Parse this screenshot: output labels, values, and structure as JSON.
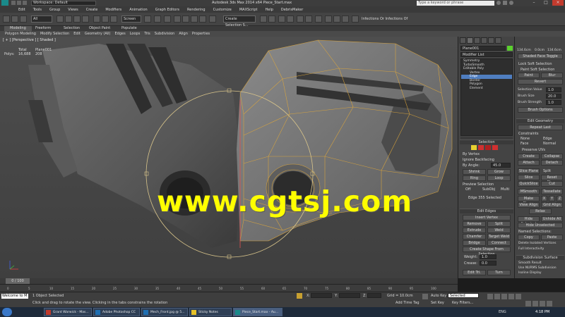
{
  "titlebar": {
    "workspace": "Workspace: Default",
    "title": "Autodesk 3ds Max 2014 x64    Piece_Start.max",
    "search_placeholder": "Type a keyword or phrase"
  },
  "menu": [
    "Edit",
    "Tools",
    "Group",
    "Views",
    "Create",
    "Modifiers",
    "Animation",
    "Graph Editors",
    "Rendering",
    "Customize",
    "MAXScript",
    "Help",
    "DebrisMaker"
  ],
  "toolbar": {
    "selection_filter": "All",
    "coord_system": "Screen",
    "named_selection": "Create Selection S...",
    "infections": "Infections Or Infections Of"
  },
  "ribbon": {
    "tabs": [
      "Modeling",
      "Freeform",
      "Selection",
      "Object Paint",
      "Populate"
    ],
    "items": [
      "Polygon Modeling",
      "Modify Selection",
      "Edit",
      "Geometry (All)",
      "Edges",
      "Loops",
      "Tris",
      "Subdivision",
      "Align",
      "Properties"
    ]
  },
  "viewport": {
    "label": "[ + ] [Perspective ] [ Shaded ]",
    "stats": {
      "col_total": "Total",
      "col_object": "Plane001",
      "row_label": "Polys:",
      "total": "16,688",
      "object": "208"
    },
    "watermark": "www.cgtsj.com"
  },
  "command_panel": {
    "object_name": "Plane001",
    "modifier_list": "Modifier List",
    "stack": [
      {
        "label": "Symmetry",
        "level": 0,
        "selected": false
      },
      {
        "label": "TurboSmooth",
        "level": 0,
        "selected": false
      },
      {
        "label": "Editable Poly",
        "level": 0,
        "selected": false
      },
      {
        "label": "Vertex",
        "level": 1,
        "selected": false
      },
      {
        "label": "Edge",
        "level": 1,
        "selected": true
      },
      {
        "label": "Border",
        "level": 1,
        "selected": false
      },
      {
        "label": "Polygon",
        "level": 1,
        "selected": false
      },
      {
        "label": "Element",
        "level": 1,
        "selected": false
      }
    ],
    "selection_rollout": "Selection",
    "by_vertex": "By Vertex",
    "ignore_backfacing": "Ignore Backfacing",
    "by_angle": "By Angle:",
    "by_angle_value": "45.0",
    "shrink": "Shrink",
    "grow": "Grow",
    "ring": "Ring",
    "loop": "Loop",
    "preview_selection": "Preview Selection",
    "preview_off": "Off",
    "preview_subobj": "SubObj",
    "preview_multi": "Multi",
    "selected_info": "Edge 355 Selected",
    "edit_edges_rollout": "Edit Edges",
    "insert_vertex": "Insert Vertex",
    "remove": "Remove",
    "split": "Split",
    "extrude": "Extrude",
    "weld": "Weld",
    "chamfer": "Chamfer",
    "target_weld": "Target Weld",
    "bridge": "Bridge",
    "connect": "Connect",
    "create_shape": "Create Shape From Selection",
    "weight_label": "Weight:",
    "weight_value": "1.0",
    "crease_label": "Crease:",
    "crease_value": "0.0",
    "edit_tri": "Edit Tri.",
    "turn": "Turn"
  },
  "right_panel": {
    "val1": "134.6cm",
    "val2": "0.0cm",
    "val3": "134.6cm",
    "shaded_toggle": "Shaded Face Toggle",
    "lock_soft": "Lock Soft Selection",
    "paint_soft": "Paint Soft Selection",
    "paint": "Paint",
    "blur": "Blur",
    "revert": "Revert",
    "selection_value": "Selection Value",
    "selection_value_num": "1.0",
    "brush_size": "Brush Size",
    "brush_size_num": "20.0",
    "brush_strength": "Brush Strength",
    "brush_strength_num": "1.0",
    "brush_options": "Brush Options",
    "edit_geometry": "Edit Geometry",
    "repeat_last": "Repeat Last",
    "constraints": "Constraints",
    "c_none": "None",
    "c_edge": "Edge",
    "c_face": "Face",
    "c_normal": "Normal",
    "preserve_uvs": "Preserve UVs",
    "create": "Create",
    "collapse": "Collapse",
    "attach": "Attach",
    "detach": "Detach",
    "slice_plane": "Slice Plane",
    "split": "Split",
    "slice": "Slice",
    "reset_plane": "Reset Plane",
    "quickslice": "QuickSlice",
    "cut": "Cut",
    "msmooth": "MSmooth",
    "tessellate": "Tessellate",
    "make_planar": "Make Planar",
    "x": "X",
    "y": "Y",
    "z": "Z",
    "view_align": "View Align",
    "grid_align": "Grid Align",
    "relax": "Relax",
    "hide_selected": "Hide Selected",
    "hide_unselected": "Hide Unselected",
    "unhide_all": "Unhide All",
    "named_selections": "Named Selections:",
    "copy": "Copy",
    "paste": "Paste",
    "delete_isolated": "Delete Isolated Vertices",
    "full_interactivity": "Full Interactivity",
    "subdivision_surface": "Subdivision Surface",
    "smooth_result": "Smooth Result",
    "use_nurms": "Use NURMS Subdivision",
    "isoline": "Isoline Display",
    "show_cage": "Show Cage......",
    "display": "Display",
    "iterations": "Iterations:",
    "iterations_value": "1"
  },
  "timeline": {
    "frame": "0 / 100",
    "ticks": [
      "0",
      "5",
      "10",
      "15",
      "20",
      "25",
      "30",
      "35",
      "40",
      "45",
      "50",
      "55",
      "60",
      "65",
      "70",
      "75",
      "80",
      "85",
      "90",
      "95",
      "100"
    ]
  },
  "status": {
    "maxscript_listener": "Welcome to M",
    "selection": "1 Object Selected",
    "prompt": "Click and drag to rotate the view.  Clicking in the tabs constrains the rotation",
    "x_label": "X:",
    "y_label": "Y:",
    "z_label": "Z:",
    "grid": "Grid = 10.0cm",
    "add_time_tag": "Add Time Tag",
    "auto_key": "Auto Key",
    "set_key": "Set Key",
    "selected": "Selected",
    "key_filters": "Key Filters..."
  },
  "taskbar": {
    "tasks": [
      "Grant Warwick - Mas...",
      "Adobe Photoshop CC",
      "Mech_Front.jpg @ 5...",
      "Sticky Notes",
      "Piece_Start.max - Au..."
    ],
    "task_colors": [
      "#c0392b",
      "#1f6fb2",
      "#1f6fb2",
      "#e6c229",
      "#1a8a8a"
    ],
    "language": "ENG",
    "clock": "4:18 PM"
  },
  "colors": {
    "wire": "#e0a83a",
    "selected_blue": "#4f7ec0",
    "watermark": "#ffff00"
  }
}
